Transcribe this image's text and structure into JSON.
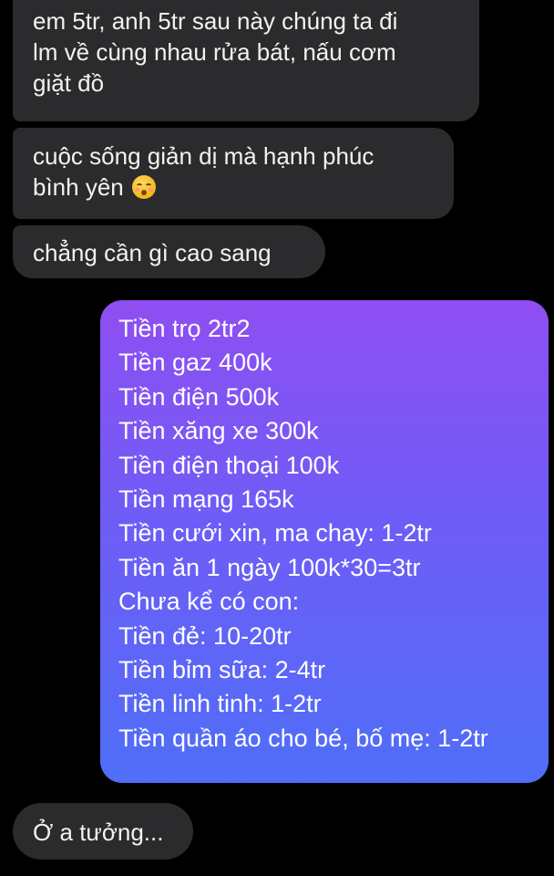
{
  "messages": [
    {
      "direction": "incoming",
      "lines": [
        "em 5tr, anh 5tr sau này chúng ta đi",
        "lm về cùng nhau rửa bát, nấu cơm",
        "giặt đồ"
      ]
    },
    {
      "direction": "incoming",
      "lines": [
        "cuộc sống giản dị mà hạnh phúc",
        "bình yên"
      ],
      "emoji": "kissing-face-with-closed-eyes-icon"
    },
    {
      "direction": "incoming",
      "lines": [
        "chẳng cần gì cao sang"
      ]
    },
    {
      "direction": "outgoing",
      "lines": [
        "Tiền trọ 2tr2",
        "Tiền gaz 400k",
        "Tiền điện 500k",
        "Tiền xăng xe 300k",
        "Tiền điện thoại 100k",
        "Tiền mạng 165k",
        "Tiền cưới xin, ma chay: 1-2tr",
        "Tiền ăn 1 ngày 100k*30=3tr",
        "Chưa kể có con:",
        "Tiền đẻ: 10-20tr",
        "Tiền bỉm sữa: 2-4tr",
        "Tiền linh tinh: 1-2tr",
        "Tiền quần áo cho bé, bố mẹ: 1-2tr"
      ]
    },
    {
      "direction": "incoming",
      "lines": [
        "Ở a tưởng..."
      ]
    }
  ],
  "colors": {
    "background": "#000000",
    "incoming_bubble": "#2b2b2d",
    "outgoing_gradient_top": "#8f4ef2",
    "outgoing_gradient_bottom": "#4f6ef8",
    "text": "#f2f2f2"
  }
}
